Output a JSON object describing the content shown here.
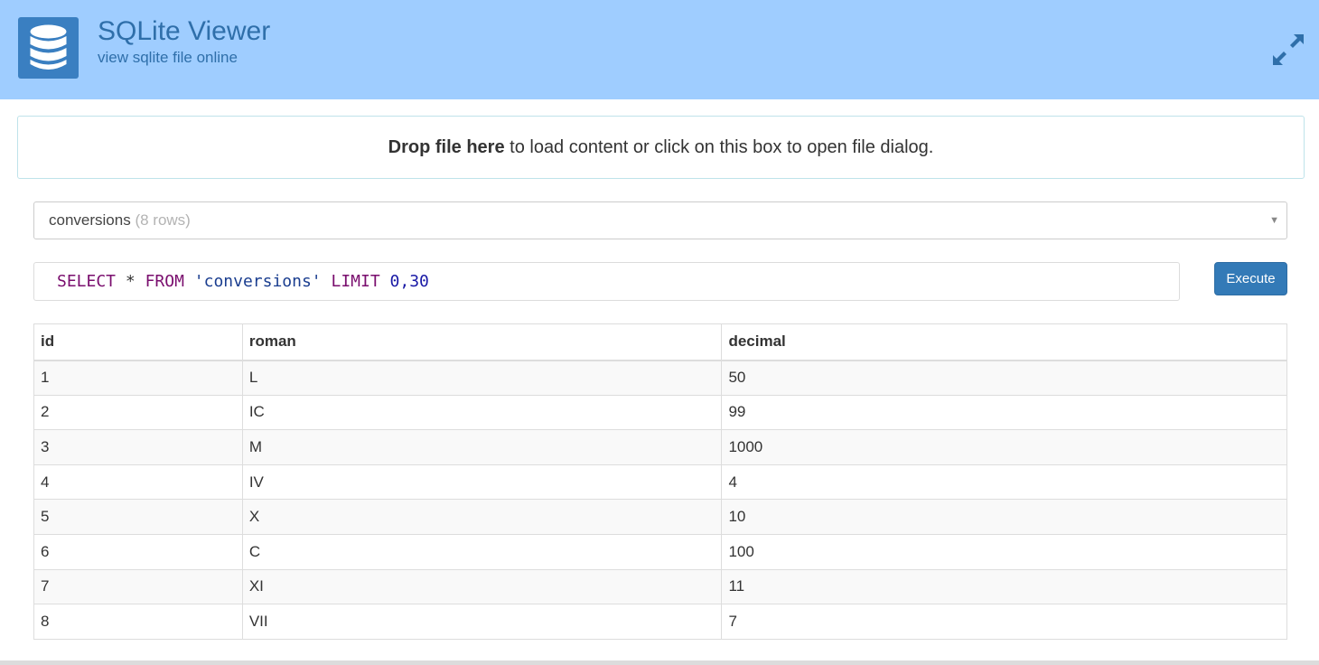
{
  "header": {
    "title": "SQLite Viewer",
    "subtitle": "view sqlite file online",
    "logo_icon": "database-icon",
    "expand_icon": "expand-icon",
    "background": "#9fcdff",
    "logo_background": "#3a7fc1"
  },
  "dropzone": {
    "bold_text": "Drop file here",
    "rest_text": " to load content or click on this box to open file dialog."
  },
  "table_select": {
    "selected_table": "conversions",
    "row_count_label": "(8 rows)"
  },
  "query": {
    "kw_select": "SELECT",
    "star": "*",
    "kw_from": "FROM",
    "table_literal": "'conversions'",
    "kw_limit": "LIMIT",
    "limit_value": "0,30"
  },
  "execute_button": {
    "label": "Execute",
    "color": "#337ab7"
  },
  "results": {
    "columns": [
      "id",
      "roman",
      "decimal"
    ],
    "rows": [
      [
        "1",
        "L",
        "50"
      ],
      [
        "2",
        "IC",
        "99"
      ],
      [
        "3",
        "M",
        "1000"
      ],
      [
        "4",
        "IV",
        "4"
      ],
      [
        "5",
        "X",
        "10"
      ],
      [
        "6",
        "C",
        "100"
      ],
      [
        "7",
        "XI",
        "11"
      ],
      [
        "8",
        "VII",
        "7"
      ]
    ]
  }
}
